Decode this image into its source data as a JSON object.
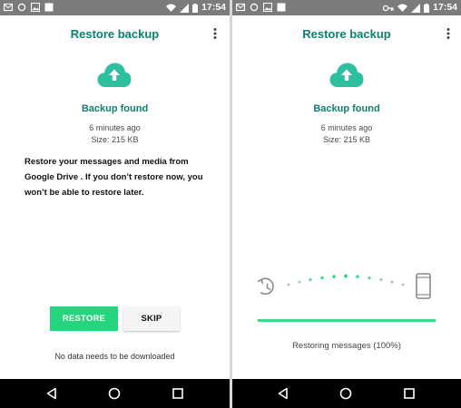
{
  "status_bar": {
    "time": "17:54",
    "icons": [
      "mail-icon",
      "sync-icon",
      "image-icon",
      "notification-icon",
      "wifi-icon",
      "key-icon",
      "signal-icon",
      "battery-icon"
    ]
  },
  "screens": [
    {
      "title": "Restore backup",
      "backup_found": "Backup found",
      "time_ago": "6 minutes ago",
      "size": "Size: 215 KB",
      "message": "Restore your messages and media from Google Drive . If you don’t restore now, you won’t be able to restore later.",
      "restore_label": "RESTORE",
      "skip_label": "SKIP",
      "footnote": "No data needs to be downloaded"
    },
    {
      "title": "Restore backup",
      "backup_found": "Backup found",
      "time_ago": "6 minutes ago",
      "size": "Size: 215 KB",
      "progress_label": "Restoring messages (100%)",
      "progress": 1.0
    }
  ],
  "colors": {
    "accent": "#0d7f6f",
    "cloud": "#2dbf9e",
    "restore_button": "#25d57e",
    "progress": "#3bd98a"
  }
}
